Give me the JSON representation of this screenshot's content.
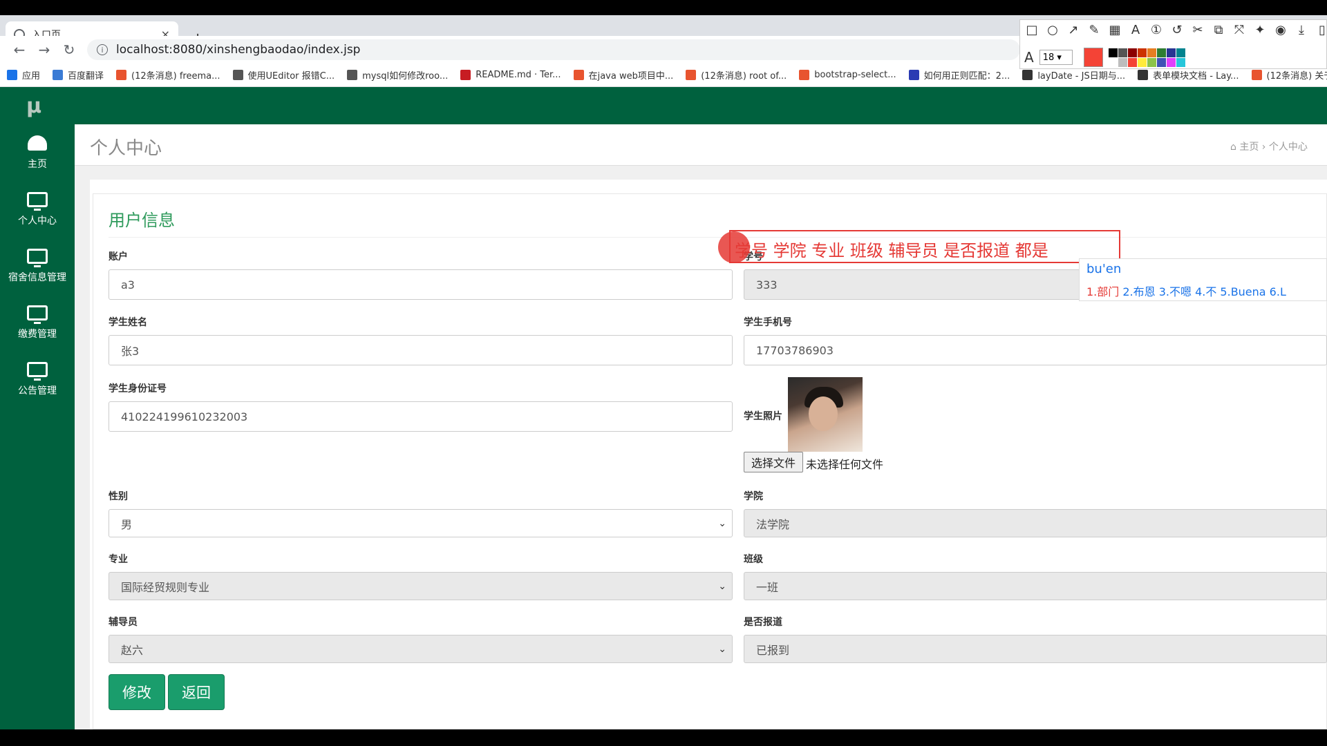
{
  "browser": {
    "tab_title": "入口页",
    "tab_close": "×",
    "new_tab": "+",
    "url": "localhost:8080/xinshengbaodao/index.jsp",
    "bookmarks": [
      {
        "label": "应用",
        "color": "#1a73e8"
      },
      {
        "label": "百度翻译",
        "color": "#3a7bd5"
      },
      {
        "label": "(12条消息) freema...",
        "color": "#e8542f"
      },
      {
        "label": "使用UEditor 报错C...",
        "color": "#555555"
      },
      {
        "label": "mysql如何修改roo...",
        "color": "#555555"
      },
      {
        "label": "README.md · Ter...",
        "color": "#c71d23"
      },
      {
        "label": "在java web项目中...",
        "color": "#e8542f"
      },
      {
        "label": "(12条消息) root of...",
        "color": "#e8542f"
      },
      {
        "label": "bootstrap-select...",
        "color": "#e8542f"
      },
      {
        "label": "如何用正则匹配：2...",
        "color": "#2b3bb3"
      },
      {
        "label": "layDate - JS日期与...",
        "color": "#333333"
      },
      {
        "label": "表单模块文档 - Lay...",
        "color": "#333333"
      },
      {
        "label": "(12条消息) 关于la...",
        "color": "#e8542f"
      }
    ]
  },
  "draw_toolbar": {
    "font_size": "18",
    "current_color": "#f44336",
    "palette": [
      "#000000",
      "#555555",
      "#8b0000",
      "#cc3300",
      "#e67e22",
      "#2e7d32",
      "#283593",
      "#00838f",
      "#ffffff",
      "#bdbdbd",
      "#f44336",
      "#ffeb3b",
      "#8bc34a",
      "#3f51b5",
      "#e040fb",
      "#26c6da"
    ]
  },
  "app": {
    "logo": "μ",
    "sidebar": [
      {
        "label": "主页",
        "icon": "dashboard-icon"
      },
      {
        "label": "个人中心",
        "icon": "monitor-icon"
      },
      {
        "label": "宿舍信息管理",
        "icon": "monitor-icon"
      },
      {
        "label": "缴费管理",
        "icon": "monitor-icon"
      },
      {
        "label": "公告管理",
        "icon": "monitor-icon"
      }
    ],
    "page_title": "个人中心",
    "breadcrumb": {
      "home": "主页",
      "sep": "›",
      "current": "个人中心"
    },
    "card_title": "用户信息",
    "fields": {
      "account": {
        "label": "账户",
        "value": "a3"
      },
      "student_no": {
        "label": "学号",
        "value": "333"
      },
      "name": {
        "label": "学生姓名",
        "value": "张3"
      },
      "phone": {
        "label": "学生手机号",
        "value": "17703786903"
      },
      "id_card": {
        "label": "学生身份证号",
        "value": "410224199610232003"
      },
      "photo": {
        "label": "学生照片",
        "choose_button": "选择文件",
        "no_file": "未选择任何文件"
      },
      "gender": {
        "label": "性别",
        "value": "男"
      },
      "college": {
        "label": "学院",
        "value": "法学院"
      },
      "major": {
        "label": "专业",
        "value": "国际经贸规则专业"
      },
      "class": {
        "label": "班级",
        "value": "一班"
      },
      "counselor": {
        "label": "辅导员",
        "value": "赵六"
      },
      "reported": {
        "label": "是否报道",
        "value": "已报到"
      }
    },
    "buttons": {
      "modify": "修改",
      "back": "返回"
    }
  },
  "annotation": {
    "text": "学号   学院 专业 班级 辅导员 是否报道 都是",
    "ime_composition": "bu'en",
    "ime_candidates": {
      "first": "1.部门",
      "rest": "  2.布恩  3.不嗯  4.不  5.Buena  6.L"
    }
  }
}
